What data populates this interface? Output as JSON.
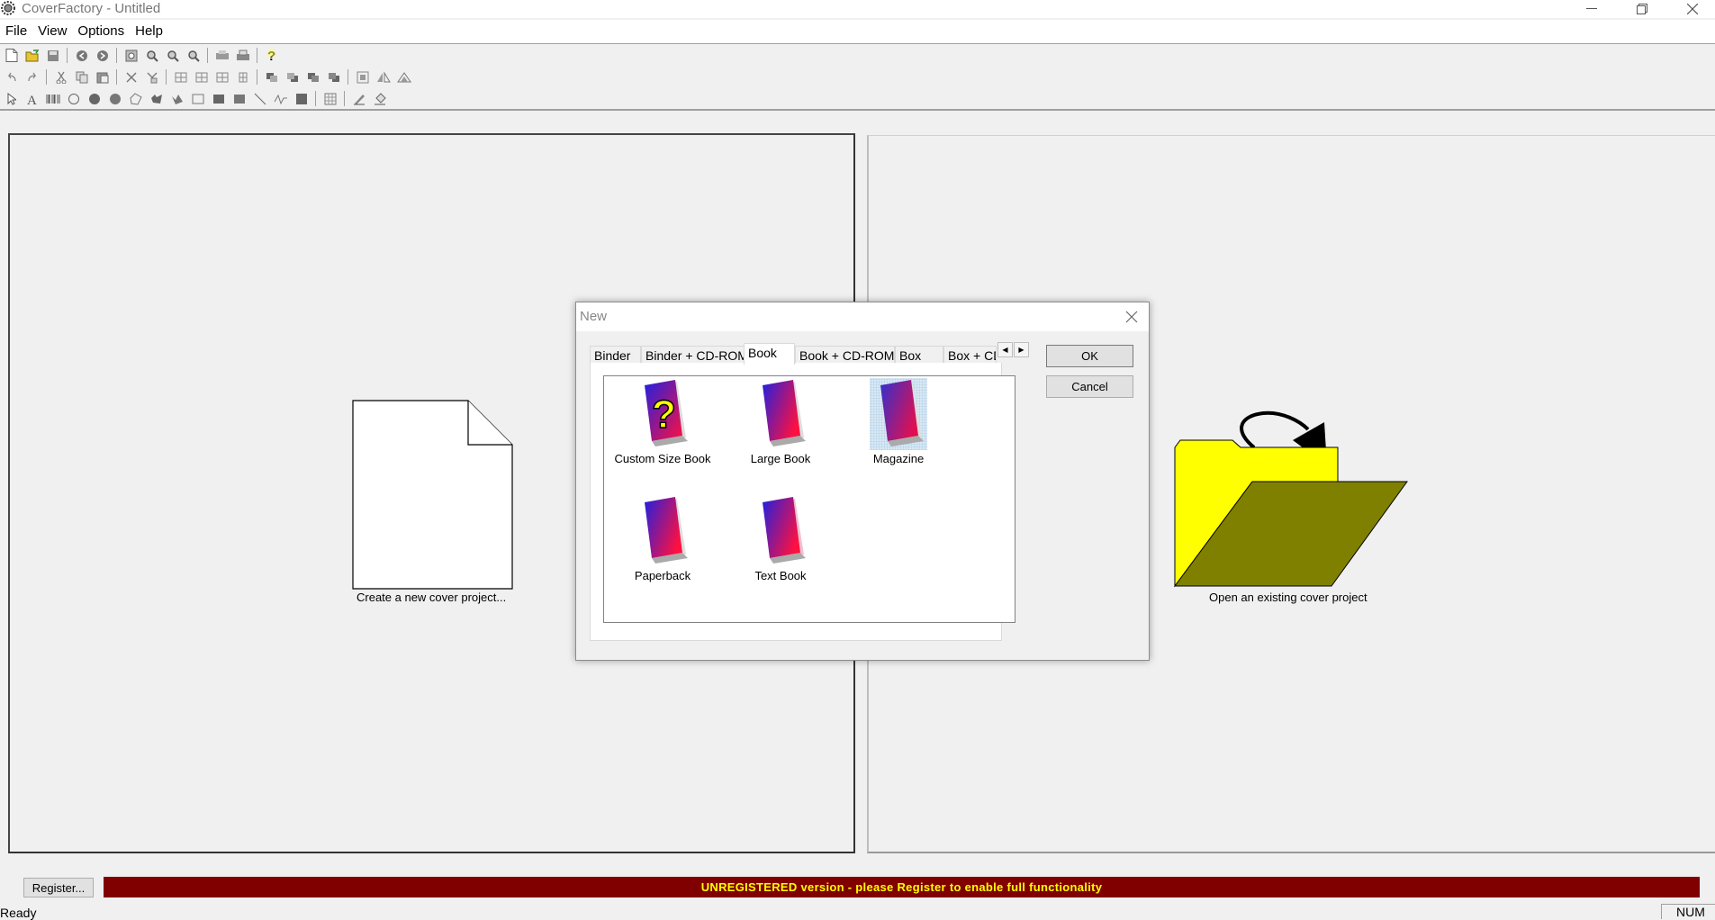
{
  "window": {
    "title": "CoverFactory - Untitled",
    "minimize_icon": "minimize-icon",
    "restore_icon": "restore-icon",
    "close_icon": "close-icon"
  },
  "menu": [
    "File",
    "View",
    "Options",
    "Help"
  ],
  "left_panel": {
    "caption": "Create a new cover project...",
    "icon": "blank-document-icon"
  },
  "right_panel": {
    "caption": "Open an existing cover project",
    "icon": "open-folder-arrow-icon",
    "colors": {
      "folder": "#ffff00",
      "folder_front": "#808000"
    }
  },
  "dialog": {
    "title": "New",
    "tabs": [
      "Binder",
      "Binder + CD-ROM",
      "Book",
      "Book + CD-ROM",
      "Box",
      "Box + CD"
    ],
    "active_tab": "Book",
    "items": [
      {
        "label": "Custom Size Book",
        "icon": "custom-size-book-icon",
        "selected": false
      },
      {
        "label": "Large Book",
        "icon": "large-book-icon",
        "selected": false
      },
      {
        "label": "Magazine",
        "icon": "magazine-icon",
        "selected": true
      },
      {
        "label": "Paperback",
        "icon": "paperback-icon",
        "selected": false
      },
      {
        "label": "Text Book",
        "icon": "text-book-icon",
        "selected": false
      }
    ],
    "ok_label": "OK",
    "cancel_label": "Cancel"
  },
  "register_label": "Register...",
  "banner": {
    "text": "UNREGISTERED version - please Register to enable full functionality",
    "bg_color": "#800000",
    "text_color": "#ffff00"
  },
  "status": {
    "text": "Ready",
    "num": "NUM"
  }
}
